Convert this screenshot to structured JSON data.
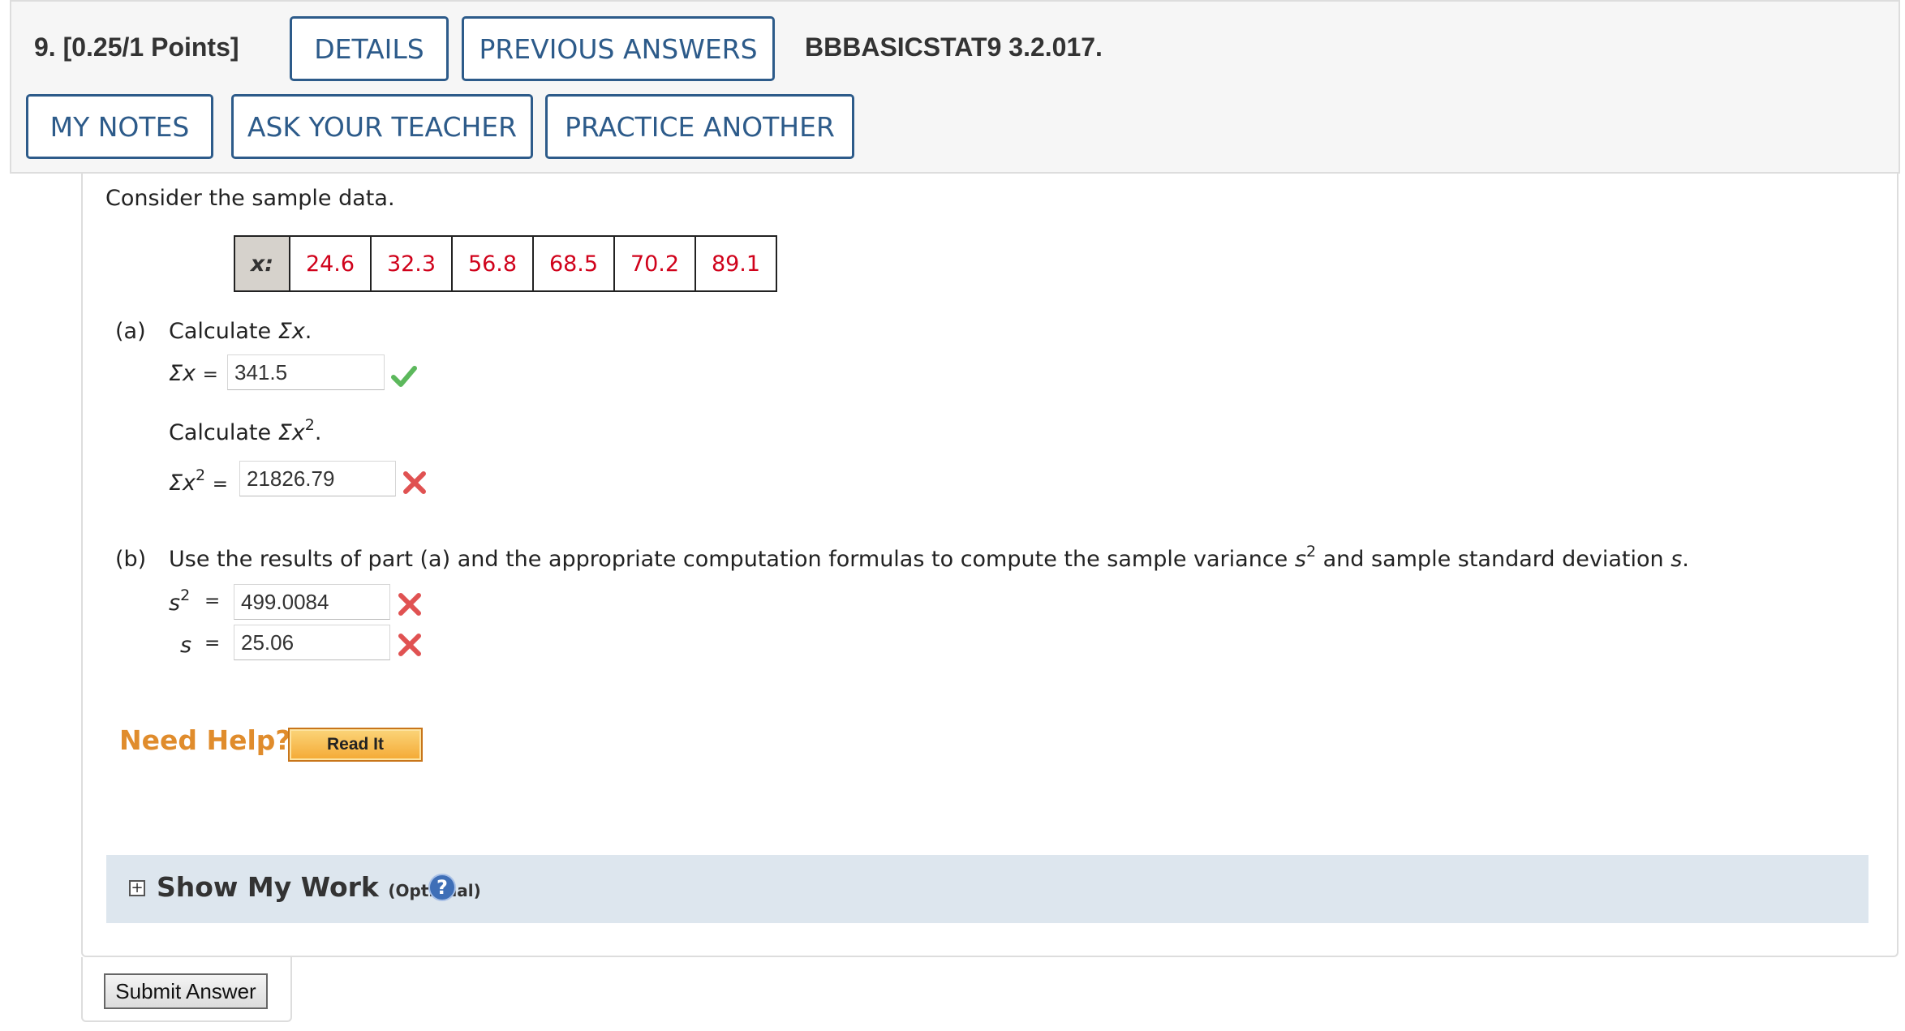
{
  "header": {
    "question_number": "9.",
    "points": "[0.25/1 Points]",
    "buttons": {
      "details": "DETAILS",
      "previous_answers": "PREVIOUS ANSWERS",
      "my_notes": "MY NOTES",
      "ask_teacher": "ASK YOUR TEACHER",
      "practice_another": "PRACTICE ANOTHER"
    },
    "question_code": "BBBASICSTAT9 3.2.017.",
    "accent_color": "#2d5b8a"
  },
  "question": {
    "intro": "Consider the sample data.",
    "table": {
      "label": "x:",
      "values": [
        "24.6",
        "32.3",
        "56.8",
        "68.5",
        "70.2",
        "89.1"
      ]
    },
    "part_a": {
      "tag": "(a)",
      "calc_sum_x": "Calculate",
      "sum_x_label": "Σx",
      "calc_sum_x2": "Calculate",
      "sum_x2_label": "Σx",
      "exponent": "2",
      "equals": "=",
      "sum_x_value": "341.5",
      "sum_x_status": "correct",
      "sum_x2_value": "21826.79",
      "sum_x2_status": "incorrect"
    },
    "part_b": {
      "tag": "(b)",
      "text_before": "Use the results of part (a) and the appropriate computation formulas to compute the sample variance",
      "var_symbol": "s",
      "text_middle": "and sample standard deviation",
      "sd_symbol": "s",
      "period": ".",
      "exponent": "2",
      "equals": "=",
      "variance_value": "499.0084",
      "variance_status": "incorrect",
      "sd_value": "25.06",
      "sd_status": "incorrect"
    },
    "help": {
      "need_help": "Need Help?",
      "read_it": "Read It"
    },
    "show_work": {
      "label": "Show My Work",
      "optional": "(Optional)",
      "help_icon": "?"
    },
    "submit_label": "Submit Answer"
  },
  "colors": {
    "correct": "#5cb85c",
    "incorrect": "#e05252",
    "data_value": "#d0021b",
    "need_help": "#e08c2c"
  }
}
